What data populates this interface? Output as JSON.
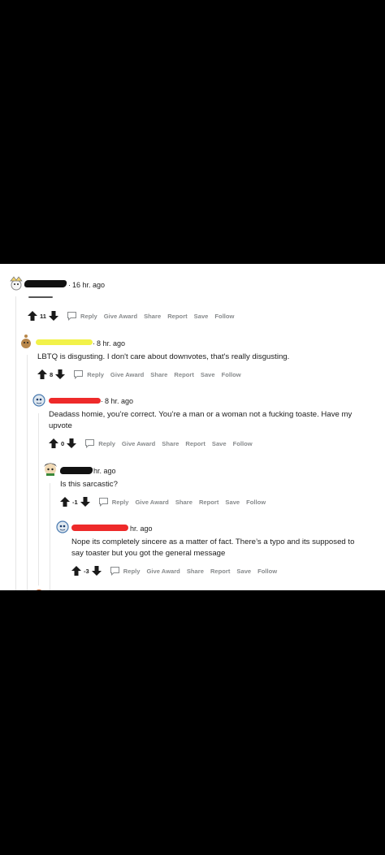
{
  "comments": [
    {
      "id": "c1",
      "time": "16 hr. ago",
      "body": "",
      "score": "11",
      "actions": [
        "Reply",
        "Give Award",
        "Share",
        "Report",
        "Save",
        "Follow"
      ]
    },
    {
      "id": "c2",
      "time": "8 hr. ago",
      "body": "LBTQ is disgusting. I don't care about downvotes, that's really disgusting.",
      "score": "8",
      "actions": [
        "Reply",
        "Give Award",
        "Share",
        "Report",
        "Save",
        "Follow"
      ]
    },
    {
      "id": "c3",
      "time": "8 hr. ago",
      "body": "Deadass homie, you’re correct. You’re a man or a woman not a fucking toaste. Have my upvote",
      "score": "0",
      "actions": [
        "Reply",
        "Give Award",
        "Share",
        "Report",
        "Save",
        "Follow"
      ]
    },
    {
      "id": "c4",
      "time": "hr. ago",
      "body": "Is this sarcastic?",
      "score": "-1",
      "actions": [
        "Reply",
        "Give Award",
        "Share",
        "Report",
        "Save",
        "Follow"
      ]
    },
    {
      "id": "c5",
      "time": "hr. ago",
      "body": "Nope its completely sincere as a matter of fact. There’s a typo and its supposed to say toaster but you got the general message",
      "score": "-3",
      "actions": [
        "Reply",
        "Give Award",
        "Share",
        "Report",
        "Save",
        "Follow"
      ]
    }
  ],
  "colors": {
    "background": "#000000",
    "panel": "#ffffff",
    "redact_black": "#111111",
    "redact_yellow": "#f2f24a",
    "redact_red": "#ee2a2a",
    "action_gray": "#878a8c"
  },
  "icons": [
    "upvote-arrow-icon",
    "downvote-arrow-icon",
    "reply-bubble-icon",
    "avatar-icon"
  ]
}
